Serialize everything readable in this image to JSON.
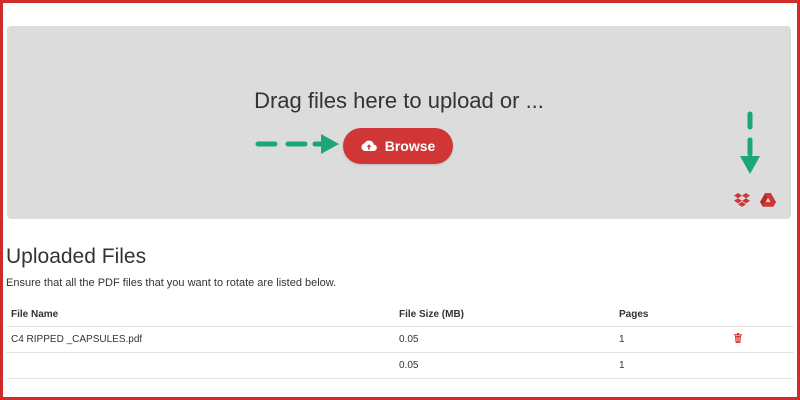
{
  "upload": {
    "drop_text": "Drag files here to upload or ...",
    "browse_label": "Browse",
    "cloud_sources": [
      {
        "icon": "dropbox-icon"
      },
      {
        "icon": "google-drive-icon"
      }
    ]
  },
  "uploaded": {
    "title": "Uploaded Files",
    "description": "Ensure that all the PDF files that you want to rotate are listed below.",
    "columns": {
      "name": "File Name",
      "size": "File Size (MB)",
      "pages": "Pages",
      "action": ""
    },
    "rows": [
      {
        "name": "C4 RIPPED _CAPSULES.pdf",
        "size": "0.05",
        "pages": "1",
        "action_icon": "trash-icon"
      },
      {
        "name": "",
        "size": "0.05",
        "pages": "1",
        "action_icon": ""
      }
    ]
  },
  "colors": {
    "accent": "#d13636",
    "frame": "#d02b2b",
    "drop_zone": "#dcdcdc",
    "annotation_arrow": "#1aa57a"
  }
}
